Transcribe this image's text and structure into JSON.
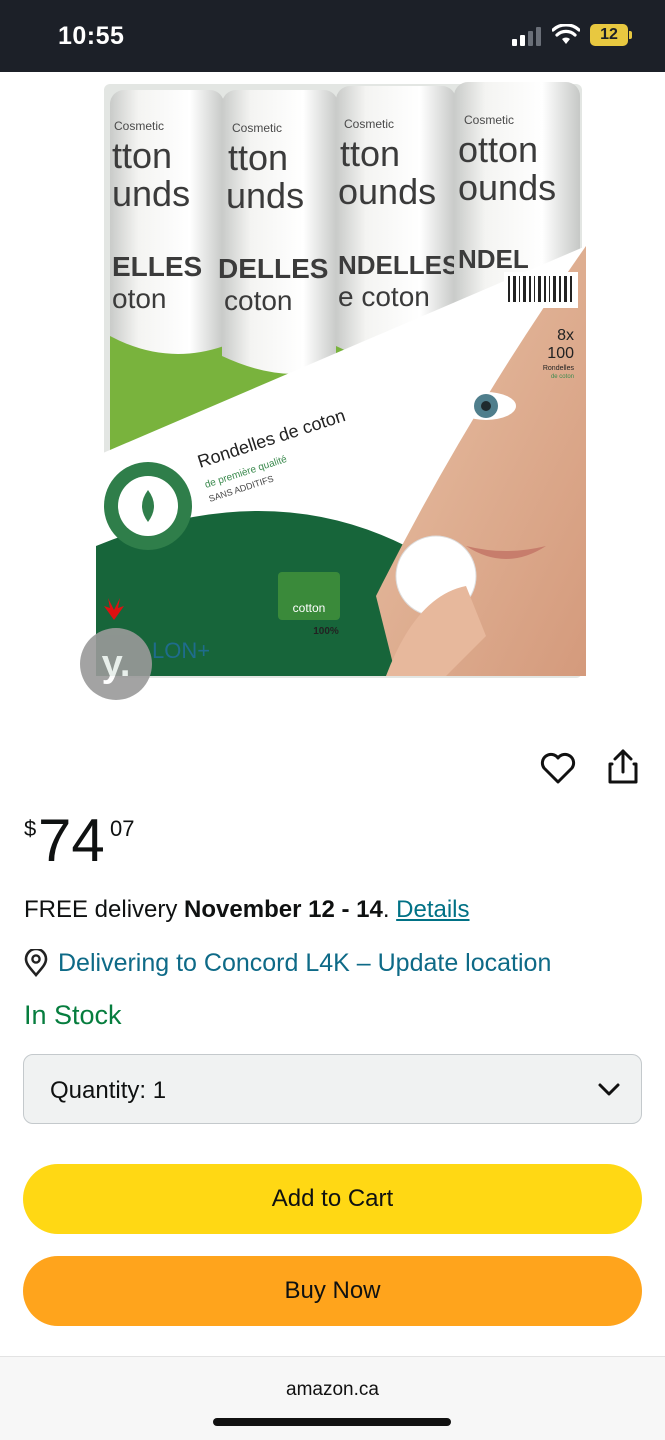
{
  "status_bar": {
    "time": "10:55",
    "battery": "12"
  },
  "product": {
    "image": {
      "rolls": [
        {
          "line1": "Cosmetic",
          "line2": "tton",
          "line3": "unds",
          "line4": "ELLES",
          "line5": "oton"
        },
        {
          "line1": "Cosmetic",
          "line2": "tton",
          "line3": "unds",
          "line4": "DELLES",
          "line5": "coton"
        },
        {
          "line1": "Cosmetic",
          "line2": "tton",
          "line3": "ounds",
          "line4": "NDELLES",
          "line5": "e coton"
        },
        {
          "line1": "Cosmetic",
          "line2": "otton",
          "line3": "ounds",
          "line4": "NDEL",
          "line5": ""
        }
      ],
      "label_title": "Rondelles de coton",
      "label_sub": "de première qualité",
      "label_sub2": "SANS ADDITIFS",
      "count": "8x",
      "count2": "100",
      "count_label": "Rondelles",
      "count_label2": "de coton",
      "cotton_logo": "cotton",
      "cotton_pct": "100%",
      "brand": "LON+"
    },
    "carousel_badge": "y."
  },
  "price": {
    "symbol": "$",
    "whole": "74",
    "fraction": "07"
  },
  "delivery": {
    "prefix": "FREE delivery ",
    "date": "November 12 - 14",
    "suffix": ". ",
    "details_link": "Details"
  },
  "location": {
    "text": "Delivering to Concord L4K – Update location",
    "icon": "location-pin-icon"
  },
  "stock": "In Stock",
  "quantity": {
    "label": "Quantity:",
    "value": "1"
  },
  "buttons": {
    "add_to_cart": "Add to Cart",
    "buy_now": "Buy Now"
  },
  "footer": {
    "url": "amazon.ca"
  },
  "colors": {
    "status_bg": "#1c2028",
    "add_to_cart": "#ffd814",
    "buy_now": "#ffa41c",
    "link": "#007185",
    "in_stock": "#067d3e"
  }
}
